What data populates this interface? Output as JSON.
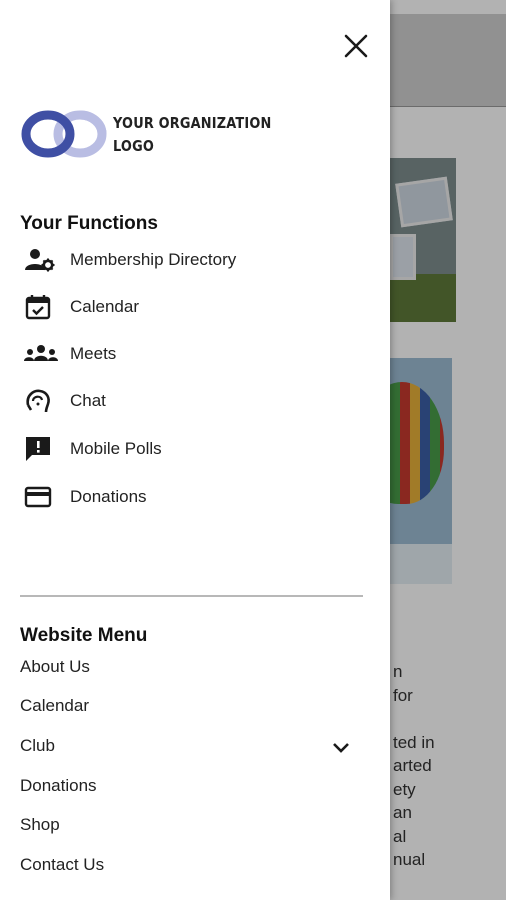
{
  "drawer": {
    "logo_line1": "YOUR ORGANIZATION",
    "logo_line2": "LOGO",
    "functions_title": "Your Functions",
    "functions": [
      {
        "label": "Membership Directory",
        "icon": "membership-directory-icon"
      },
      {
        "label": "Calendar",
        "icon": "calendar-icon"
      },
      {
        "label": "Meets",
        "icon": "group-icon"
      },
      {
        "label": "Chat",
        "icon": "chat-icon"
      },
      {
        "label": "Mobile Polls",
        "icon": "poll-icon"
      },
      {
        "label": "Donations",
        "icon": "card-icon"
      }
    ],
    "website_menu_title": "Website Menu",
    "website_menu": [
      "About Us",
      "Calendar",
      "Club",
      "Donations",
      "Shop",
      "Contact Us"
    ]
  },
  "background": {
    "text_lines": "n\nfor\n\nted in\narted\nety\nan\nal\nnual"
  },
  "colors": {
    "logo_dark": "#3f4fa4",
    "logo_light": "#b9bde3",
    "icon": "#1a1a1a",
    "scrim": "rgba(0,0,0,0.30)"
  }
}
